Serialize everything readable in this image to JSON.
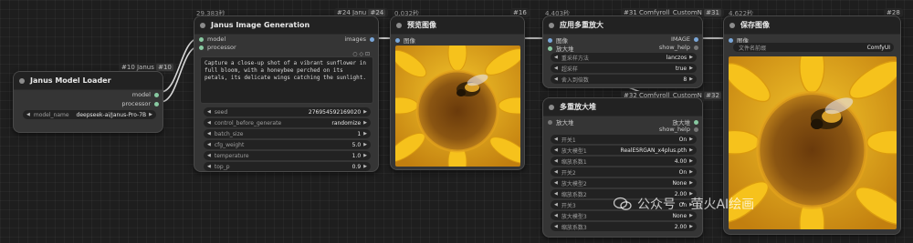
{
  "loader": {
    "badge": "#10 Janus",
    "badge_id": "#10",
    "title": "Janus Model Loader",
    "outputs": [
      "model",
      "processor"
    ],
    "widget": {
      "label": "model_name",
      "value": "deepseek-ai/Janus-Pro-7B"
    }
  },
  "janus_gen": {
    "time": "29.383秒",
    "badge": "#24 Janu",
    "badge_id": "#24",
    "title": "Janus Image Generation",
    "inputs": [
      "model",
      "processor"
    ],
    "output": "images",
    "prompt": "Capture a close-up shot of a vibrant sunflower in full bloom, with a honeybee perched on its petals, its delicate wings catching the sunlight.",
    "widgets": [
      {
        "label": "seed",
        "value": "276954592169020"
      },
      {
        "label": "control_before_generate",
        "value": "randomize"
      },
      {
        "label": "batch_size",
        "value": "1"
      },
      {
        "label": "cfg_weight",
        "value": "5.0"
      },
      {
        "label": "temperature",
        "value": "1.0"
      },
      {
        "label": "top_p",
        "value": "0.9"
      }
    ]
  },
  "preview": {
    "time": "0.032秒",
    "badge": "#16",
    "title": "预览图像",
    "input": "图像"
  },
  "upscale_apply": {
    "time": "4.403秒",
    "badge": "#31 Comfyroll_CustomN",
    "badge_id": "#31",
    "title": "应用多重放大",
    "inputs": [
      "图像",
      "放大堆"
    ],
    "outputs": [
      "IMAGE",
      "show_help"
    ],
    "widgets": [
      {
        "label": "重采样方法",
        "value": "lanczos"
      },
      {
        "label": "超采样",
        "value": "true"
      },
      {
        "label": "舍入到倍数",
        "value": "8"
      }
    ]
  },
  "upscale_stack": {
    "badge": "#32 Comfyroll_CustomN",
    "badge_id": "#32",
    "title": "多重放大堆",
    "input": "放大堆",
    "outputs": [
      "放大堆",
      "show_help"
    ],
    "widgets": [
      {
        "label": "开关1",
        "value": "On"
      },
      {
        "label": "放大模型1",
        "value": "RealESRGAN_x4plus.pth"
      },
      {
        "label": "缩放系数1",
        "value": "4.00"
      },
      {
        "label": "开关2",
        "value": "On"
      },
      {
        "label": "放大模型2",
        "value": "None"
      },
      {
        "label": "缩放系数2",
        "value": "2.00"
      },
      {
        "label": "开关3",
        "value": "On"
      },
      {
        "label": "放大模型3",
        "value": "None"
      },
      {
        "label": "缩放系数3",
        "value": "2.00"
      }
    ]
  },
  "save": {
    "time": "4.622秒",
    "badge": "#28",
    "title": "保存图像",
    "input": "图像",
    "widget": {
      "label": "文件名前缀",
      "value": "ComfyUI"
    }
  },
  "watermark": {
    "platform": "公众号",
    "separator": "·",
    "author": "萤火AI绘画"
  },
  "colors": {
    "canvas": "#1e1e1e",
    "node_body": "#353535",
    "node_title": "#222222",
    "slot_green": "#88c9a1",
    "slot_blue": "#7aa7d9",
    "link": "#d9d9d9"
  }
}
